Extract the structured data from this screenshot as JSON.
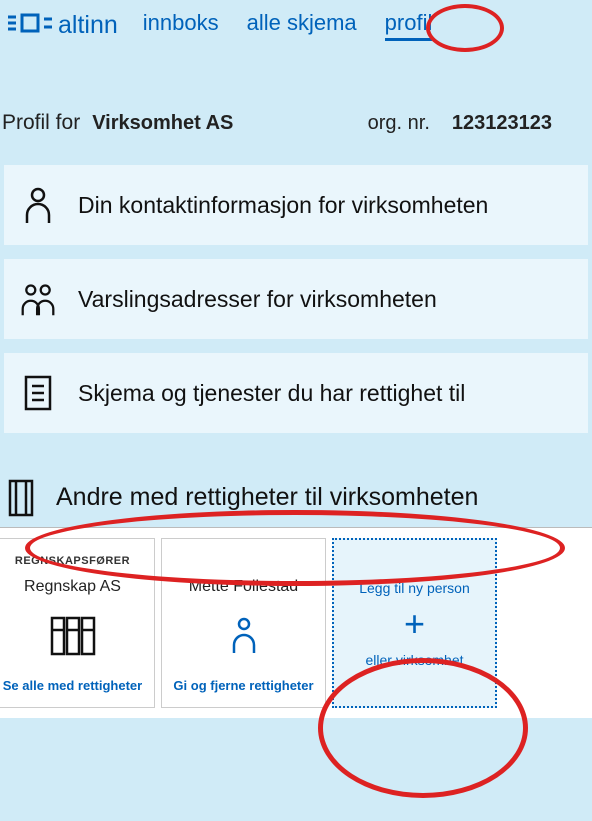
{
  "header": {
    "brand": "altinn",
    "nav": {
      "inbox": "innboks",
      "forms": "alle skjema",
      "profile": "profil"
    }
  },
  "profile": {
    "label": "Profil for",
    "name": "Virksomhet AS",
    "org_label": "org. nr.",
    "org_value": "123123123"
  },
  "panels": {
    "contact": "Din kontaktinformasjon for virksomheten",
    "notify": "Varslingsadresser for virksomheten",
    "services": "Skjema og tjenester du har rettighet til"
  },
  "section": {
    "others": "Andre med rettigheter til virksomheten"
  },
  "cards": {
    "c1": {
      "role": "REGNSKAPSFØRER",
      "name": "Regnskap AS",
      "action": "Se alle med rettigheter"
    },
    "c2": {
      "name": "Mette Follestad",
      "action": "Gi og fjerne rettigheter"
    },
    "add": {
      "line1": "Legg til ny person",
      "line2": "eller virksomhet"
    }
  }
}
